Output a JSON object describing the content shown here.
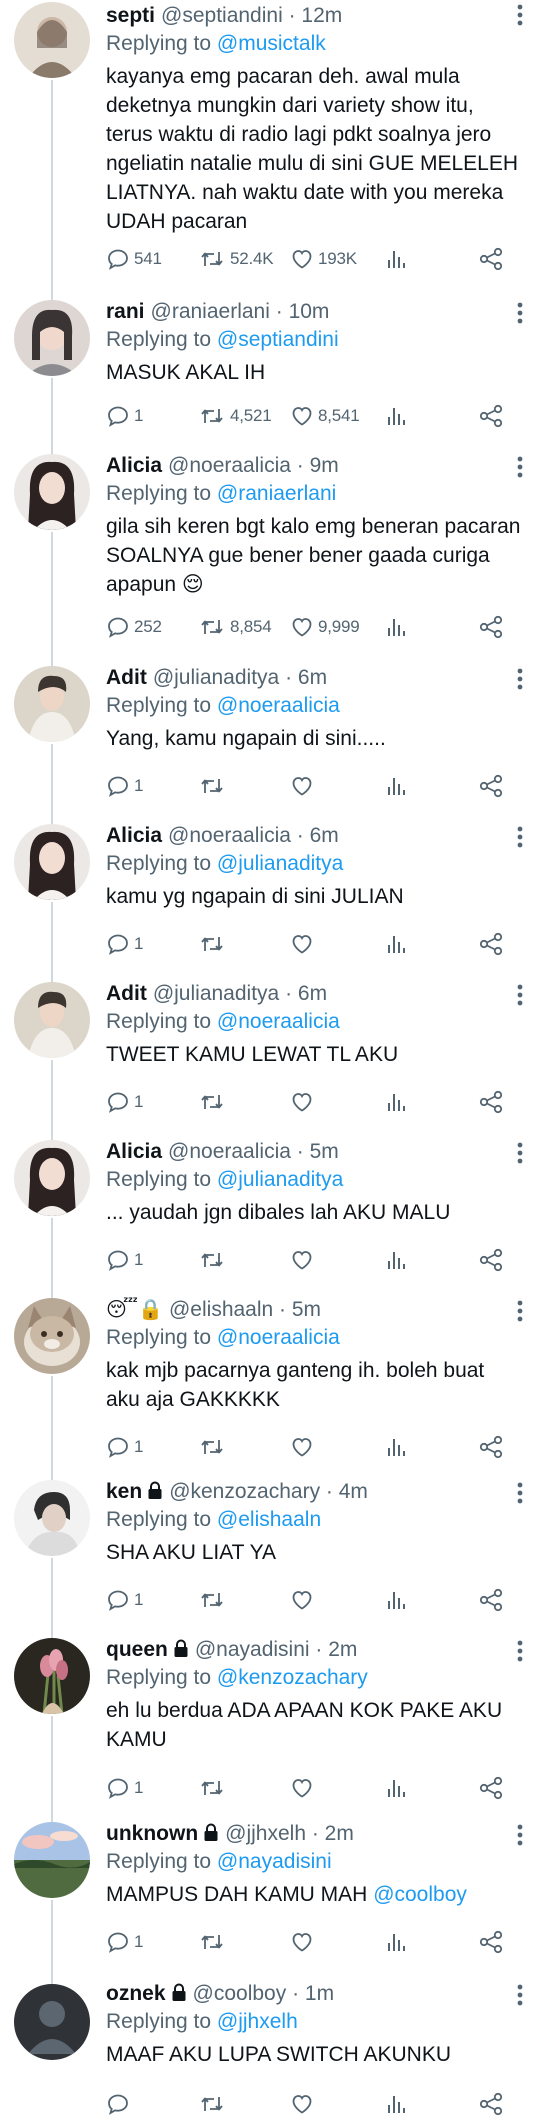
{
  "tweets": [
    {
      "name": "septi",
      "handle": "@septiandini",
      "time": "· 12m",
      "replying_prefix": "Replying to",
      "replying_to": "@musictalk",
      "text": "kayanya emg pacaran deh. awal mula deketnya mungkin dari variety show itu, terus waktu di radio lagi pdkt soalnya jero ngeliatin natalie mulu di sini GUE MELELEH LIATNYA. nah waktu date with you mereka UDAH pacaran",
      "replies": "541",
      "retweets": "52.4K",
      "likes": "193K",
      "avatar_colors": [
        "#d9cfc2",
        "#8a7a6a"
      ]
    },
    {
      "name": "rani",
      "handle": "@raniaerlani",
      "time": "· 10m",
      "replying_prefix": "Replying to",
      "replying_to": "@septiandini",
      "text": "MASUK AKAL IH",
      "replies": "1",
      "retweets": "4,521",
      "likes": "8,541",
      "avatar_colors": [
        "#d8d0cc",
        "#3a3434"
      ]
    },
    {
      "name": "Alicia",
      "handle": "@noeraalicia",
      "time": "· 9m",
      "replying_prefix": "Replying to",
      "replying_to": "@raniaerlani",
      "text": "gila sih keren bgt kalo emg beneran pacaran SOALNYA gue bener bener gaada curiga apapun 😌",
      "replies": "252",
      "retweets": "8,854",
      "likes": "9,999",
      "avatar_colors": [
        "#e8e4e2",
        "#2b2221"
      ]
    },
    {
      "name": "Adit",
      "handle": "@julianaditya",
      "time": "· 6m",
      "replying_prefix": "Replying to",
      "replying_to": "@noeraalicia",
      "text": "Yang, kamu ngapain di sini.....",
      "replies": "1",
      "retweets": "",
      "likes": "",
      "avatar_colors": [
        "#d6cfc3",
        "#3d3530"
      ]
    },
    {
      "name": "Alicia",
      "handle": "@noeraalicia",
      "time": "· 6m",
      "replying_prefix": "Replying to",
      "replying_to": "@julianaditya",
      "text": "kamu yg ngapain di sini JULIAN",
      "replies": "1",
      "retweets": "",
      "likes": "",
      "avatar_colors": [
        "#e8e4e2",
        "#2b2221"
      ]
    },
    {
      "name": "Adit",
      "handle": "@julianaditya",
      "time": "· 6m",
      "replying_prefix": "Replying to",
      "replying_to": "@noeraalicia",
      "text": "TWEET KAMU LEWAT TL AKU",
      "replies": "1",
      "retweets": "",
      "likes": "",
      "avatar_colors": [
        "#d6cfc3",
        "#3d3530"
      ]
    },
    {
      "name": "Alicia",
      "handle": "@noeraalicia",
      "time": "· 5m",
      "replying_prefix": "Replying to",
      "replying_to": "@julianaditya",
      "text": "... yaudah jgn dibales lah AKU MALU",
      "replies": "1",
      "retweets": "",
      "likes": "",
      "avatar_colors": [
        "#e8e4e2",
        "#2b2221"
      ]
    },
    {
      "name": "😴🔒",
      "handle": "@elishaaln",
      "time": "· 5m",
      "replying_prefix": "Replying to",
      "replying_to": "@noeraalicia",
      "text": "kak mjb pacarnya ganteng ih. boleh buat aku aja GAKKKKK",
      "replies": "1",
      "retweets": "",
      "likes": "",
      "avatar_colors": [
        "#c9b9a4",
        "#6b5a48"
      ]
    },
    {
      "name": "ken",
      "handle": "@kenzozachary",
      "time": "· 4m",
      "replying_prefix": "Replying to",
      "replying_to": "@elishaaln",
      "text": "SHA AKU LIAT YA",
      "replies": "1",
      "retweets": "",
      "likes": "",
      "avatar_colors": [
        "#eeeeee",
        "#2f2f2f"
      ]
    },
    {
      "name": "queen",
      "handle": "@nayadisini",
      "time": "· 2m",
      "replying_prefix": "Replying to",
      "replying_to": "@kenzozachary",
      "text": "eh lu berdua ADA APAAN KOK PAKE AKU KAMU",
      "replies": "1",
      "retweets": "",
      "likes": "",
      "avatar_colors": [
        "#2a2620",
        "#d98a9a"
      ]
    },
    {
      "name": "unknown",
      "handle": "@jjhxelh",
      "time": "· 2m",
      "replying_prefix": "Replying to",
      "replying_to": "@nayadisini",
      "text_before": "MAMPUS DAH KAMU MAH ",
      "text_mention": "@coolboy",
      "replies": "1",
      "retweets": "",
      "likes": "",
      "avatar_colors": [
        "#a9c3e6",
        "#4f6b3f"
      ]
    },
    {
      "name": "oznek",
      "handle": "@coolboy",
      "time": "· 1m",
      "replying_prefix": "Replying to",
      "replying_to": "@jjhxelh",
      "text": "MAAF AKU LUPA SWITCH AKUNKU",
      "replies": "",
      "retweets": "",
      "likes": "",
      "avatar_colors": [
        "#333a40",
        "#5b6670"
      ]
    }
  ],
  "icons": {
    "reply": "comment-icon",
    "retweet": "retweet-icon",
    "like": "heart-icon",
    "views": "analytics-icon",
    "share": "share-icon",
    "more": "more-vertical-icon",
    "lock": "lock-icon"
  },
  "colors": {
    "link": "#1d9bf0",
    "muted": "#536471",
    "text": "#0f1419",
    "line": "#cfd9de"
  }
}
